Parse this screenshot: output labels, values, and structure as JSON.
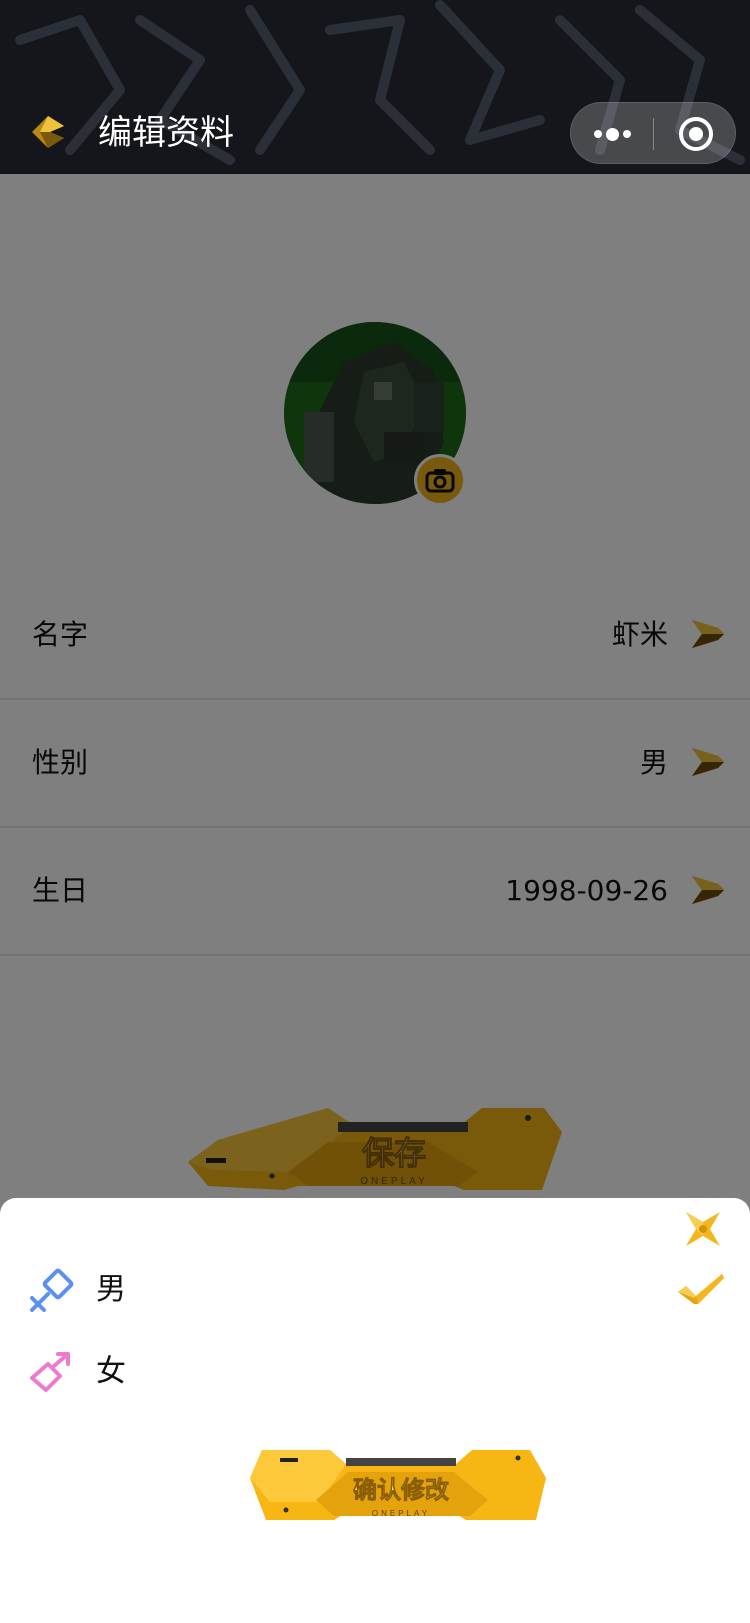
{
  "header": {
    "title": "编辑资料",
    "menu_icon": "more-dots-icon",
    "close_icon": "target-circle-icon"
  },
  "profile": {
    "avatar_icon": "avatar-image",
    "camera_icon": "camera-icon"
  },
  "fields": [
    {
      "label": "名字",
      "value": "虾米"
    },
    {
      "label": "性别",
      "value": "男"
    },
    {
      "label": "生日",
      "value": "1998-09-26"
    }
  ],
  "save_button": {
    "label": "保存",
    "sub": "ONEPLAY"
  },
  "sheet": {
    "options": [
      {
        "label": "男",
        "icon": "male-symbol-icon",
        "color": "#5b8ff3"
      },
      {
        "label": "女",
        "icon": "female-symbol-icon",
        "color": "#ec7bd0"
      }
    ],
    "confirm_button": {
      "label": "确认修改",
      "sub": "ONEPLAY"
    }
  },
  "colors": {
    "accent": "#f5b51c",
    "header_bg": "#14161b"
  }
}
